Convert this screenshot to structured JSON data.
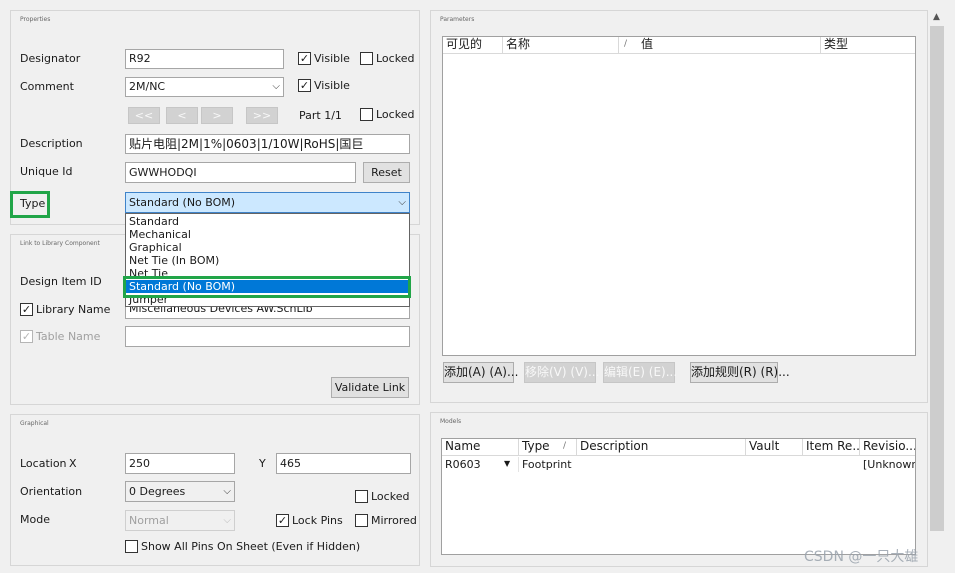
{
  "properties": {
    "title": "Properties",
    "designator_label": "Designator",
    "designator_value": "R92",
    "visible_label": "Visible",
    "locked_label": "Locked",
    "comment_label": "Comment",
    "comment_value": "2M/NC",
    "nav_first": "<<",
    "nav_prev": "<",
    "nav_next": ">",
    "nav_last": ">>",
    "part_label": "Part 1/1",
    "description_label": "Description",
    "description_value": "贴片电阻|2M|1%|0603|1/10W|RoHS|国巨",
    "unique_id_label": "Unique Id",
    "unique_id_value": "GWWHODQI",
    "reset_button": "Reset",
    "type_label": "Type",
    "type_value": "Standard (No BOM)",
    "type_options": [
      "Standard",
      "Mechanical",
      "Graphical",
      "Net Tie (In BOM)",
      "Net Tie",
      "Standard (No BOM)",
      "Jumper"
    ]
  },
  "library": {
    "title": "Link to Library Component",
    "design_item_label": "Design Item ID",
    "library_name_label": "Library Name",
    "library_name_value": "Miscellaneous Devices AW.SchLib",
    "table_name_label": "Table Name",
    "validate_button": "Validate Link"
  },
  "graphical": {
    "title": "Graphical",
    "location_label": "Location",
    "x_label": "X",
    "x_value": "250",
    "y_label": "Y",
    "y_value": "465",
    "orientation_label": "Orientation",
    "orientation_value": "0 Degrees",
    "mode_label": "Mode",
    "mode_value": "Normal",
    "locked_label": "Locked",
    "lock_pins_label": "Lock Pins",
    "mirrored_label": "Mirrored",
    "show_pins_label": "Show All Pins On Sheet (Even if Hidden)"
  },
  "parameters": {
    "title": "Parameters",
    "columns": [
      "可见的",
      "名称",
      "/",
      "值",
      "类型"
    ],
    "add_button": "添加(A) (A)...",
    "remove_button": "移除(V) (V)...",
    "edit_button": "编辑(E) (E)...",
    "add_rule_button": "添加规则(R) (R)..."
  },
  "models": {
    "title": "Models",
    "columns": [
      "Name",
      "Type",
      "/",
      "Description",
      "Vault",
      "Item Re...",
      "Revisio..."
    ],
    "row": {
      "name": "R0603",
      "type": "Footprint",
      "description": "",
      "vault": "",
      "item_rev": "",
      "revision": "[Unknowr"
    }
  },
  "watermark": "CSDN @一只大雄"
}
